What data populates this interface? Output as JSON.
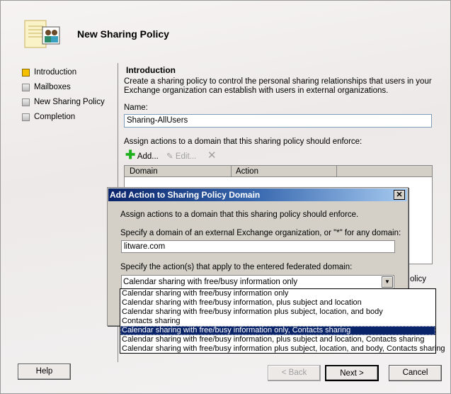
{
  "wizard": {
    "title": "New Sharing Policy",
    "nav": [
      {
        "label": "Introduction",
        "active": true
      },
      {
        "label": "Mailboxes"
      },
      {
        "label": "New Sharing Policy"
      },
      {
        "label": "Completion"
      }
    ],
    "section_title": "Introduction",
    "description_1": "Create a sharing policy to control the personal sharing relationships that users in your",
    "description_2": "Exchange organization can establish with users in external organizations.",
    "name_label": "Name:",
    "name_value": "Sharing-AllUsers",
    "assign_text": "Assign actions to a domain that this sharing policy should enforce:",
    "toolbar": {
      "add": "Add...",
      "edit": "Edit..."
    },
    "columns": [
      "Domain",
      "Action"
    ],
    "partial_text": "olicy",
    "buttons": {
      "help": "Help",
      "back": "< Back",
      "next": "Next >",
      "cancel": "Cancel"
    }
  },
  "dialog": {
    "title": "Add Action to Sharing Policy Domain",
    "intro": "Assign actions to a domain that this sharing policy should enforce.",
    "domain_label": "Specify a domain of an external Exchange organization, or \"*\" for any domain:",
    "domain_value": "litware.com",
    "action_label": "Specify the action(s) that apply to the entered federated domain:",
    "action_value": "Calendar sharing with free/busy information only",
    "options": [
      "Calendar sharing with free/busy information only",
      "Calendar sharing with free/busy information, plus subject and location",
      "Calendar sharing with free/busy information plus subject, location, and body",
      "Contacts sharing",
      "Calendar sharing with free/busy information only, Contacts sharing",
      "Calendar sharing with free/busy information, plus subject and location, Contacts sharing",
      "Calendar sharing with free/busy information plus subject, location, and body, Contacts sharing"
    ],
    "selected_index": 4
  }
}
